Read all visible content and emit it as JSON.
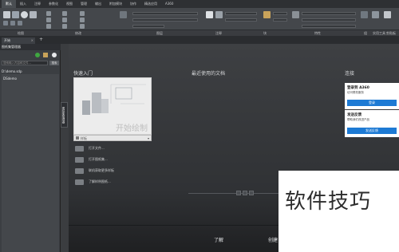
{
  "ribbon": {
    "tabs": [
      "默认",
      "插入",
      "注释",
      "参数化",
      "视图",
      "管理",
      "输出",
      "附加模块",
      "协作",
      "精选应用",
      "A360"
    ],
    "groups": [
      "绘图",
      "修改",
      "图层",
      "注释",
      "块",
      "特性",
      "组",
      "实用工具",
      "剪贴板"
    ]
  },
  "document_tabs": {
    "start": "开始",
    "close": "×",
    "new_tab": "+"
  },
  "palette": {
    "title": "图纸集管理器",
    "search_placeholder": "搜索输入内容和文件...",
    "search_button": "搜索",
    "path": "D:\\demo.sdp",
    "items": [
      "DSdemo"
    ],
    "side_label": "图纸集管理器"
  },
  "main": {
    "quick_start_heading": "快速入门",
    "recent_heading": "最近使用的文档",
    "connect_heading": "连接",
    "create_card_text": "开始绘制",
    "template_label": "样板",
    "quick_links": [
      "打开文件...",
      "打开图纸集...",
      "联机获取更多样板",
      "了解样例图纸..."
    ],
    "connect_a360": {
      "title": "登录到 A360",
      "subtitle": "访问联机服务",
      "button": "登录"
    },
    "connect_feedback": {
      "title": "发送反馈",
      "subtitle": "帮助我们改进产品",
      "button": "发送反馈"
    },
    "footer": {
      "learn": "了解",
      "create": "创建"
    }
  },
  "watermark": {
    "text": "软件技巧"
  },
  "colors": {
    "accent_blue": "#1d7ad4",
    "ribbon_bg": "#44474b",
    "app_bg": "#3b3d40"
  }
}
